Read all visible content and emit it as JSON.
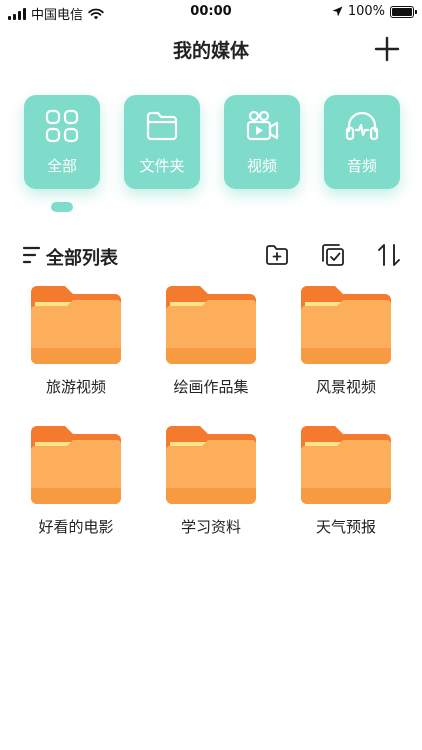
{
  "status_bar": {
    "carrier": "中国电信",
    "time": "00:00",
    "battery": "100%",
    "battery_level": 1.0
  },
  "header": {
    "title": "我的媒体",
    "add_icon": "plus-icon"
  },
  "categories": [
    {
      "label": "全部",
      "icon": "grid-icon",
      "selected": true
    },
    {
      "label": "文件夹",
      "icon": "folder-icon",
      "selected": false
    },
    {
      "label": "视频",
      "icon": "video-camera-icon",
      "selected": false
    },
    {
      "label": "音频",
      "icon": "headphones-icon",
      "selected": false
    }
  ],
  "list": {
    "title": "全部列表",
    "tools": [
      "new-folder-icon",
      "multi-select-icon",
      "sort-icon"
    ]
  },
  "folders": [
    {
      "name": "旅游视频"
    },
    {
      "name": "绘画作品集"
    },
    {
      "name": "风景视频"
    },
    {
      "name": "好看的电影"
    },
    {
      "name": "学习资料"
    },
    {
      "name": "天气预报"
    }
  ],
  "colors": {
    "accent": "#7fdcca",
    "folder_body": "#fdae5b",
    "folder_tab": "#f47a2e",
    "folder_paper": "#fde48a"
  }
}
